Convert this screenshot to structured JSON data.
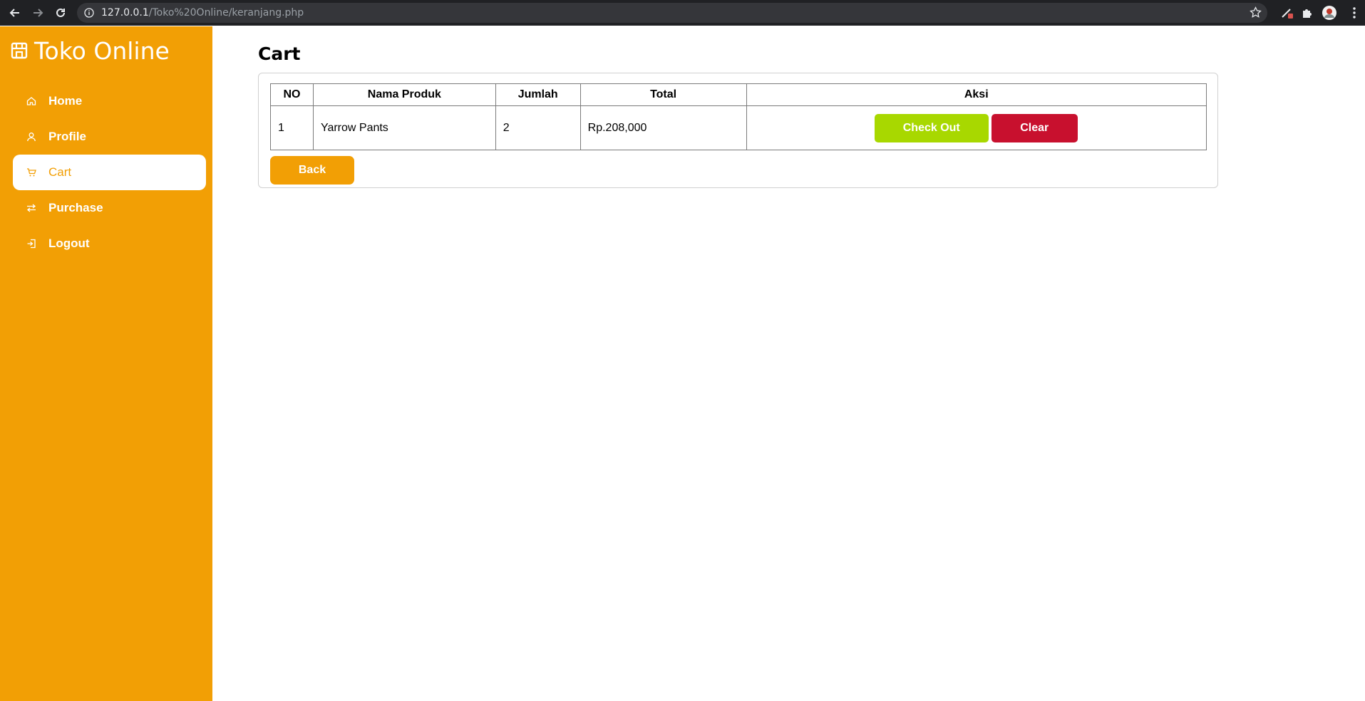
{
  "browser": {
    "url_host": "127.0.0.1",
    "url_path": "/Toko%20Online/keranjang.php"
  },
  "sidebar": {
    "brand": "Toko Online",
    "items": [
      {
        "label": "Home",
        "icon": "home-icon",
        "active": false
      },
      {
        "label": "Profile",
        "icon": "user-icon",
        "active": false
      },
      {
        "label": "Cart",
        "icon": "cart-icon",
        "active": true
      },
      {
        "label": "Purchase",
        "icon": "arrows-exchange-icon",
        "active": false
      },
      {
        "label": "Logout",
        "icon": "logout-icon",
        "active": false
      }
    ]
  },
  "main": {
    "title": "Cart",
    "table": {
      "headers": [
        "NO",
        "Nama Produk",
        "Jumlah",
        "Total",
        "Aksi"
      ],
      "rows": [
        {
          "no": "1",
          "product": "Yarrow Pants",
          "qty": "2",
          "total": "Rp.208,000"
        }
      ]
    },
    "checkout_label": "Check Out",
    "clear_label": "Clear",
    "back_label": "Back"
  },
  "colors": {
    "accent": "#f29f05",
    "checkout": "#a8d800",
    "clear": "#c8102e"
  }
}
